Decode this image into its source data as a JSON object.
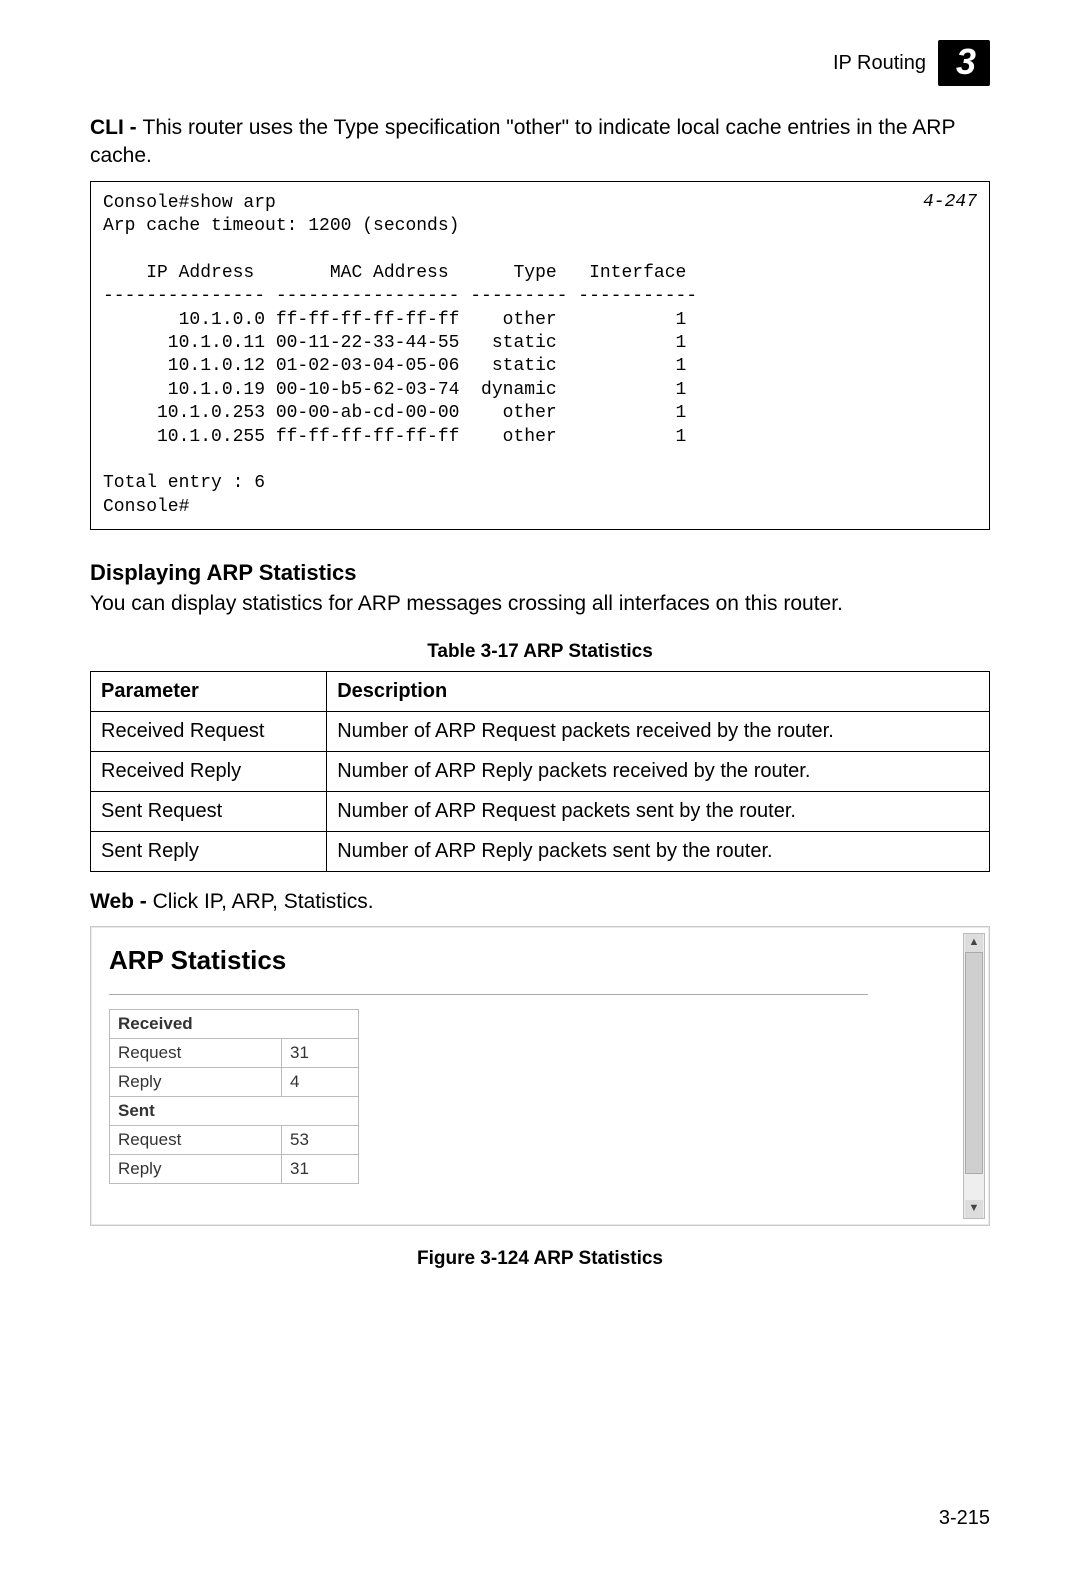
{
  "header": {
    "section": "IP Routing",
    "chapter": "3"
  },
  "intro": {
    "prefix": "CLI - ",
    "text": "This router uses the Type specification \"other\" to indicate local cache entries in the ARP cache."
  },
  "cli": {
    "ref": "4-247",
    "lines": [
      "Console#show arp",
      "Arp cache timeout: 1200 (seconds)",
      "",
      "    IP Address       MAC Address      Type   Interface",
      "--------------- ----------------- --------- -----------",
      "       10.1.0.0 ff-ff-ff-ff-ff-ff    other           1",
      "      10.1.0.11 00-11-22-33-44-55   static           1",
      "      10.1.0.12 01-02-03-04-05-06   static           1",
      "      10.1.0.19 00-10-b5-62-03-74  dynamic           1",
      "     10.1.0.253 00-00-ab-cd-00-00    other           1",
      "     10.1.0.255 ff-ff-ff-ff-ff-ff    other           1",
      "",
      "Total entry : 6",
      "Console#"
    ]
  },
  "section": {
    "title": "Displaying ARP Statistics",
    "text": "You can display statistics for ARP messages crossing all interfaces on this router."
  },
  "table": {
    "caption": "Table 3-17  ARP Statistics",
    "headers": {
      "c0": "Parameter",
      "c1": "Description"
    },
    "rows": [
      {
        "c0": "Received Request",
        "c1": "Number of ARP Request packets received by the router."
      },
      {
        "c0": "Received Reply",
        "c1": "Number of ARP Reply packets received by the router."
      },
      {
        "c0": "Sent Request",
        "c1": "Number of ARP Request packets sent by the router."
      },
      {
        "c0": "Sent Reply",
        "c1": "Number of ARP Reply packets sent by the router."
      }
    ]
  },
  "web": {
    "prefix": "Web - ",
    "text": "Click IP, ARP, Statistics.",
    "panel_title": "ARP Statistics",
    "groups": {
      "received": {
        "label": "Received",
        "request_label": "Request",
        "request_val": "31",
        "reply_label": "Reply",
        "reply_val": "4"
      },
      "sent": {
        "label": "Sent",
        "request_label": "Request",
        "request_val": "53",
        "reply_label": "Reply",
        "reply_val": "31"
      }
    },
    "figure_caption": "Figure 3-124  ARP Statistics"
  },
  "page_number": "3-215"
}
